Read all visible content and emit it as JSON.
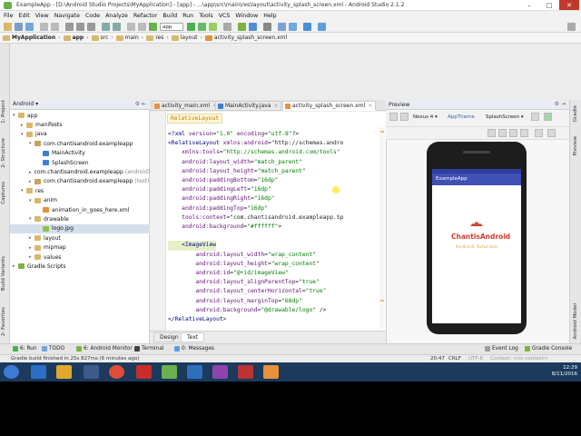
{
  "window": {
    "title": "ExampleApp - [D:\\Android Studio Projects\\MyApplication] - [app] - ...\\app\\src\\main\\res\\layout\\activity_splash_screen.xml - Android Studio 2.1.2",
    "minimize": "–",
    "maximize": "□",
    "close": "✕"
  },
  "menu": [
    "File",
    "Edit",
    "View",
    "Navigate",
    "Code",
    "Analyze",
    "Refactor",
    "Build",
    "Run",
    "Tools",
    "VCS",
    "Window",
    "Help"
  ],
  "toolbar": {
    "run_config": "app"
  },
  "nav": {
    "crumbs": [
      "MyApplication",
      "app",
      "src",
      "main",
      "res",
      "layout",
      "activity_splash_screen.xml"
    ]
  },
  "left_strip": [
    "1: Project",
    "2: Structure",
    "Captures",
    "Build Variants",
    "2: Favorites"
  ],
  "project_panel": {
    "selector": "Android",
    "tree": [
      {
        "label": "app",
        "indent": 0,
        "arrow": "▾",
        "icon": "folder"
      },
      {
        "label": "manifests",
        "indent": 1,
        "arrow": "▸",
        "icon": "folder"
      },
      {
        "label": "java",
        "indent": 1,
        "arrow": "▾",
        "icon": "folder"
      },
      {
        "label": "com.chantisandroid.exampleapp",
        "indent": 2,
        "arrow": "▾",
        "icon": "package"
      },
      {
        "label": "MainActivity",
        "indent": 3,
        "arrow": "",
        "icon": "class"
      },
      {
        "label": "SplashScreen",
        "indent": 3,
        "arrow": "",
        "icon": "class"
      },
      {
        "label": "com.chantisandroid.exampleapp",
        "suffix": "(androidTest)",
        "indent": 2,
        "arrow": "▸",
        "icon": "package"
      },
      {
        "label": "com.chantisandroid.exampleapp",
        "suffix": "(test)",
        "indent": 2,
        "arrow": "▸",
        "icon": "package"
      },
      {
        "label": "res",
        "indent": 1,
        "arrow": "▾",
        "icon": "folder"
      },
      {
        "label": "anim",
        "indent": 2,
        "arrow": "▾",
        "icon": "folder"
      },
      {
        "label": "animation_in_goes_here.xml",
        "indent": 3,
        "arrow": "",
        "icon": "xml"
      },
      {
        "label": "drawable",
        "indent": 2,
        "arrow": "▾",
        "icon": "folder"
      },
      {
        "label": "logo.jpg",
        "indent": 3,
        "arrow": "",
        "icon": "image",
        "selected": true
      },
      {
        "label": "layout",
        "indent": 2,
        "arrow": "▸",
        "icon": "folder"
      },
      {
        "label": "mipmap",
        "indent": 2,
        "arrow": "▸",
        "icon": "folder"
      },
      {
        "label": "values",
        "indent": 2,
        "arrow": "▸",
        "icon": "folder"
      },
      {
        "label": "Gradle Scripts",
        "indent": 0,
        "arrow": "▸",
        "icon": "gradle"
      }
    ]
  },
  "editor_tabs": [
    {
      "label": "activity_main.xml",
      "active": false,
      "color": "#e8903a"
    },
    {
      "label": "MainActivity.java",
      "active": false,
      "color": "#3a7fd5"
    },
    {
      "label": "activity_splash_screen.xml",
      "active": true,
      "color": "#e8903a"
    }
  ],
  "editor": {
    "hint": "RelativeLayout",
    "lines": [
      "<?xml version=\"1.0\" encoding=\"utf-8\"?>",
      "<RelativeLayout xmlns:android=\"http://schemas.andro",
      "    xmlns:tools=\"http://schemas.android.com/tools\"",
      "    android:layout_width=\"match_parent\"",
      "    android:layout_height=\"match_parent\"",
      "    android:paddingBottom=\"16dp\"",
      "    android:paddingLeft=\"16dp\"",
      "    android:paddingRight=\"16dp\"",
      "    android:paddingTop=\"16dp\"",
      "    tools:context=\"com.chantisandroid.exampleapp.Sp",
      "    android:background=\"#ffffff\">",
      "",
      "    <ImageView",
      "        android:layout_width=\"wrap_content\"",
      "        android:layout_height=\"wrap_content\"",
      "        android:id=\"@+id/imageView\"",
      "        android:layout_alignParentTop=\"true\"",
      "        android:layout_centerHorizontal=\"true\"",
      "        android:layout_marginTop=\"68dp\"",
      "        android:background=\"@drawable/logo\" />",
      "</RelativeLayout>"
    ]
  },
  "design_tabs": [
    "Design",
    "Text"
  ],
  "preview": {
    "title": "Preview",
    "device": "Nexus 4",
    "theme": "AppTheme",
    "activity": "SplashScreen",
    "app_title": "ExampleApp",
    "logo_top": "ChantisAndroid",
    "logo_bottom": "Android Tutorials"
  },
  "right_strip": [
    "Gradle",
    "Preview",
    "Android Model"
  ],
  "bottom_tabs": [
    "6: Run",
    "TODO",
    "6: Android Monitor",
    "Terminal",
    "0: Messages",
    "Event Log",
    "Gradle Console"
  ],
  "status": {
    "message": "Gradle build finished in 25s 827ms (6 minutes ago)",
    "position": "20:47",
    "line_sep": "CRLF",
    "encoding": "UTF-8",
    "context": "Context: <no context>"
  },
  "taskbar": {
    "time": "12:29",
    "date": "8/11/2016"
  },
  "colors": {
    "accent": "#3f51b5",
    "status_dark": "#303f9f"
  }
}
